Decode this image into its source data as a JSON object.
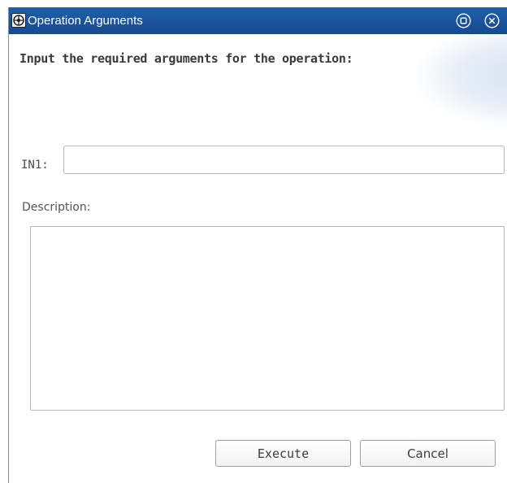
{
  "window": {
    "title": "Operation Arguments",
    "icon": "operation-gear-icon",
    "controls": {
      "maximize_icon": "maximize-circle-icon",
      "close_icon": "close-circle-icon"
    }
  },
  "form": {
    "instruction": "Input the required arguments for the operation:",
    "fields": [
      {
        "label": "IN1:",
        "value": ""
      }
    ],
    "description": {
      "label": "Description:",
      "value": ""
    }
  },
  "buttons": {
    "execute_label": "Execute",
    "cancel_label": "Cancel"
  },
  "colors": {
    "titlebar": "#1a55a0",
    "title_text": "#ffffff",
    "field_border": "#b7b7b7"
  }
}
